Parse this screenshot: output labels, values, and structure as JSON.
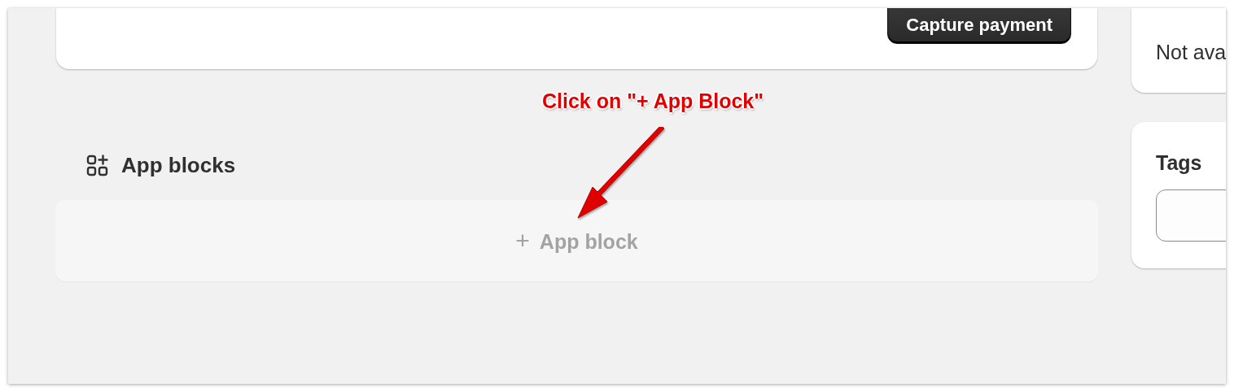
{
  "order_card": {
    "button": "Capture payment"
  },
  "side_cards": [
    {
      "kind": "note",
      "text": "Not ava"
    },
    {
      "kind": "field",
      "title": "Tags"
    }
  ],
  "app_blocks": {
    "title": "App blocks",
    "add_button": "App block",
    "add_icon": "+"
  },
  "annotation": {
    "text": "Click on \"+ App Block\""
  }
}
